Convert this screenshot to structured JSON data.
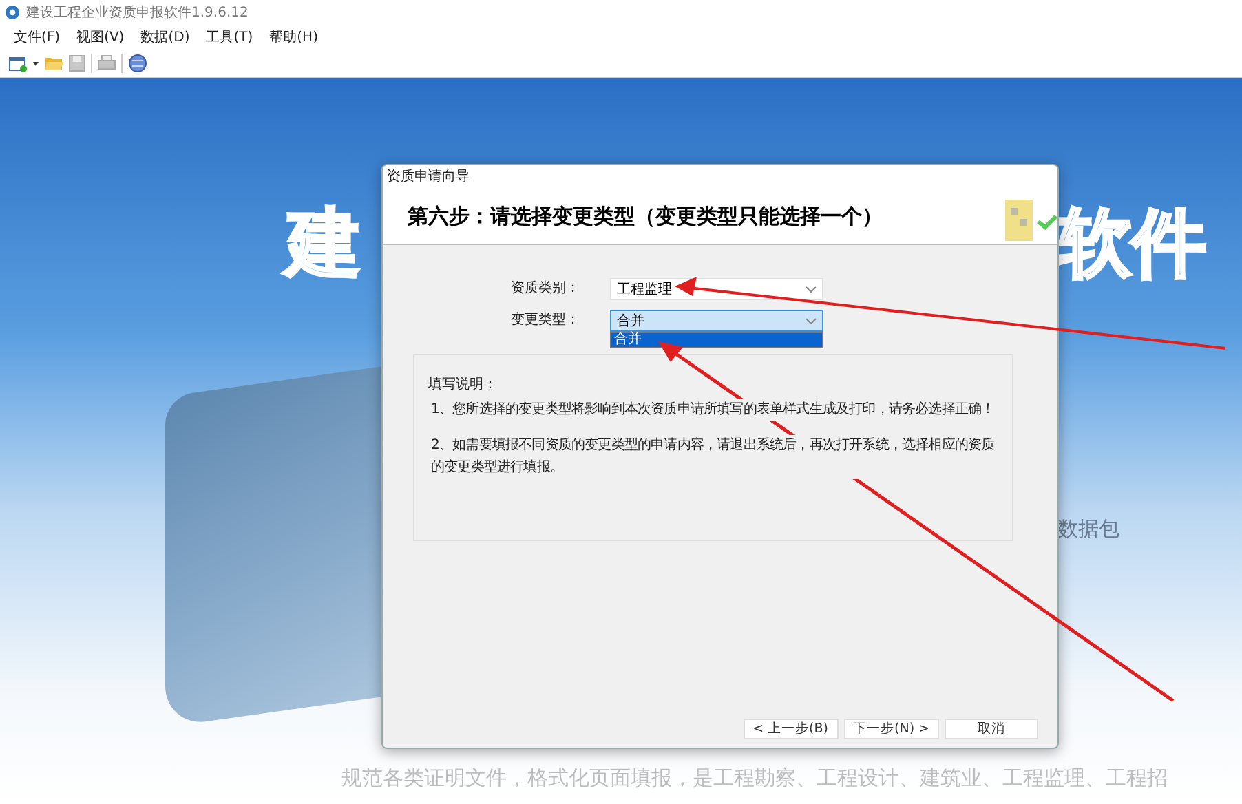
{
  "window": {
    "title": "建设工程企业资质申报软件1.9.6.12"
  },
  "menu": [
    "文件(F)",
    "视图(V)",
    "数据(D)",
    "工具(T)",
    "帮助(H)"
  ],
  "background": {
    "logo_left": "建",
    "logo_right": "软件",
    "side_text": "数据包",
    "tagline": "规范各类证明文件，格式化页面填报，是工程勘察、工程设计、建筑业、工程监理、工程招"
  },
  "dialog": {
    "title": "资质申请向导",
    "heading": "第六步：请选择变更类型（变更类型只能选择一个）",
    "fields": [
      {
        "label": "资质类别：",
        "value": "工程监理",
        "open": false
      },
      {
        "label": "变更类型：",
        "value": "合并",
        "open": true,
        "options": [
          {
            "label": "合并",
            "selected": true
          }
        ]
      }
    ],
    "instructions": {
      "title": "填写说明：",
      "items": [
        "1、您所选择的变更类型将影响到本次资质申请所填写的表单样式生成及打印，请务必选择正确！",
        "2、如需要填报不同资质的变更类型的申请内容，请退出系统后，再次打开系统，选择相应的资质的变更类型进行填报。"
      ]
    },
    "buttons": [
      {
        "label": "< 上一步(B)",
        "disabled": false
      },
      {
        "label": "下一步(N) >",
        "disabled": false
      },
      {
        "label": "取消",
        "disabled": false
      }
    ]
  }
}
